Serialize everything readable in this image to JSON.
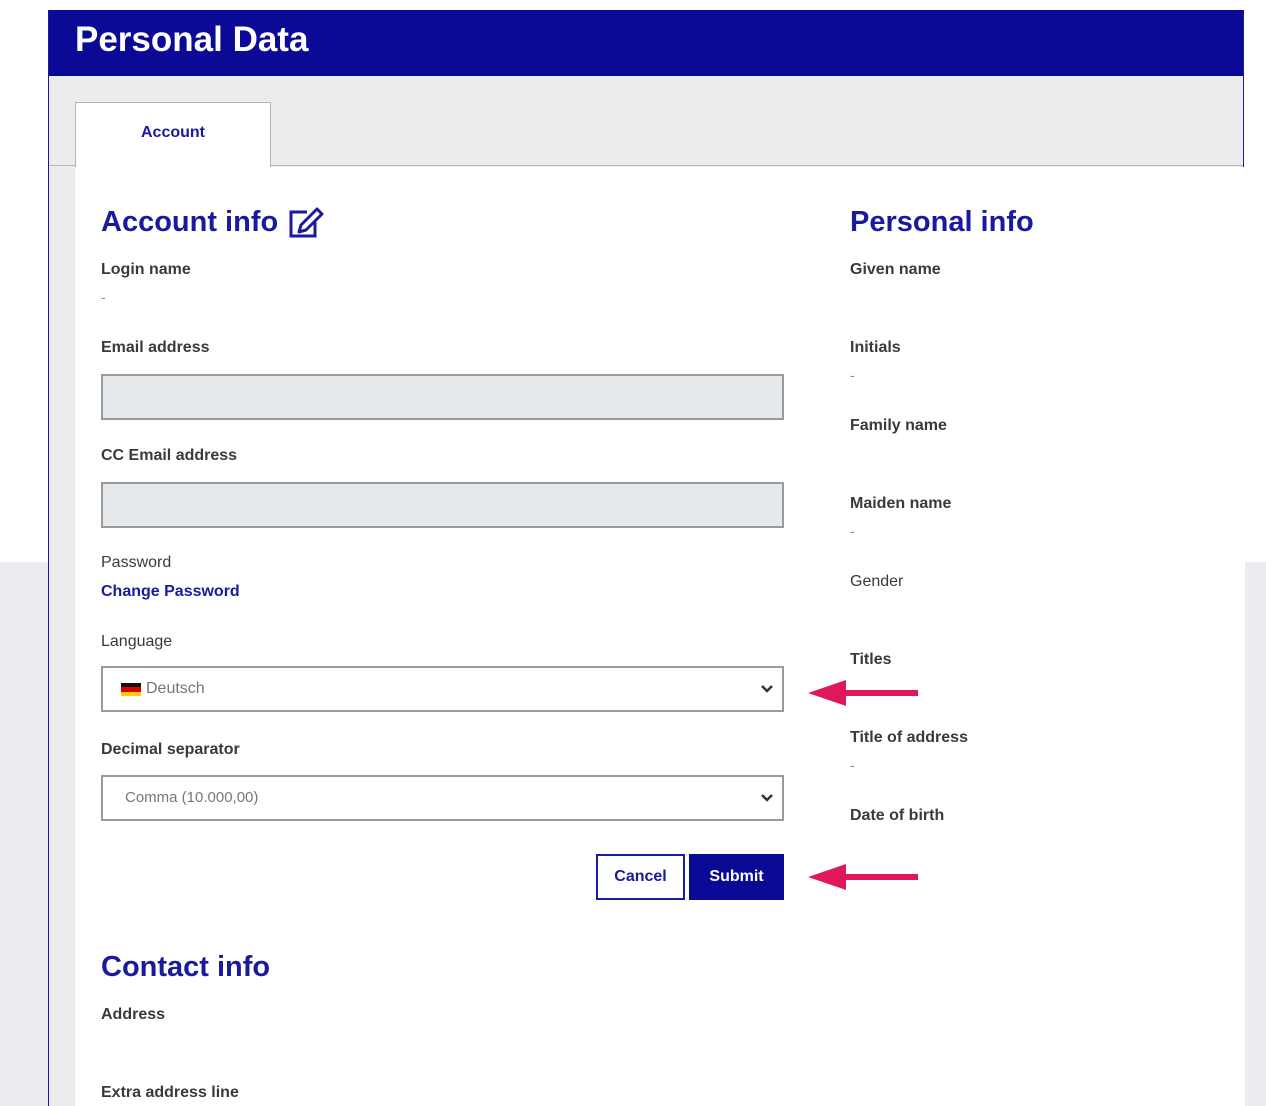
{
  "window": {
    "title": "Personal Data"
  },
  "tabs": [
    {
      "label": "Account",
      "active": true
    }
  ],
  "account_info": {
    "title": "Account info",
    "edit_icon": "edit-icon",
    "login_name": {
      "label": "Login name",
      "value": "-"
    },
    "email": {
      "label": "Email address",
      "value": "",
      "placeholder": ""
    },
    "cc_email": {
      "label": "CC Email address",
      "value": "",
      "placeholder": ""
    },
    "password": {
      "label": "Password",
      "link": "Change Password"
    },
    "language": {
      "label": "Language",
      "selected": "Deutsch",
      "flag": "de-flag-icon"
    },
    "decimal_separator": {
      "label": "Decimal separator",
      "selected": "Comma (10.000,00)"
    },
    "buttons": {
      "cancel": "Cancel",
      "submit": "Submit"
    }
  },
  "personal_info": {
    "title": "Personal info",
    "fields": [
      {
        "label": "Given name",
        "value": ""
      },
      {
        "label": "Initials",
        "value": "-"
      },
      {
        "label": "Family name",
        "value": ""
      },
      {
        "label": "Maiden name",
        "value": "-"
      },
      {
        "label": "Gender",
        "value": ""
      },
      {
        "label": "Titles",
        "value": ""
      },
      {
        "label": "Title of address",
        "value": "-"
      },
      {
        "label": "Date of birth",
        "value": ""
      }
    ]
  },
  "contact_info": {
    "title": "Contact info",
    "fields": [
      {
        "label": "Address"
      },
      {
        "label": "Extra address line"
      }
    ]
  },
  "annotations": {
    "arrow_color": "#e0185a",
    "arrow_icon": "arrow-left-icon"
  },
  "colors": {
    "brand": "#0a0a96",
    "accent_text": "#1a1a9e",
    "input_bg": "#e6e9ec"
  }
}
